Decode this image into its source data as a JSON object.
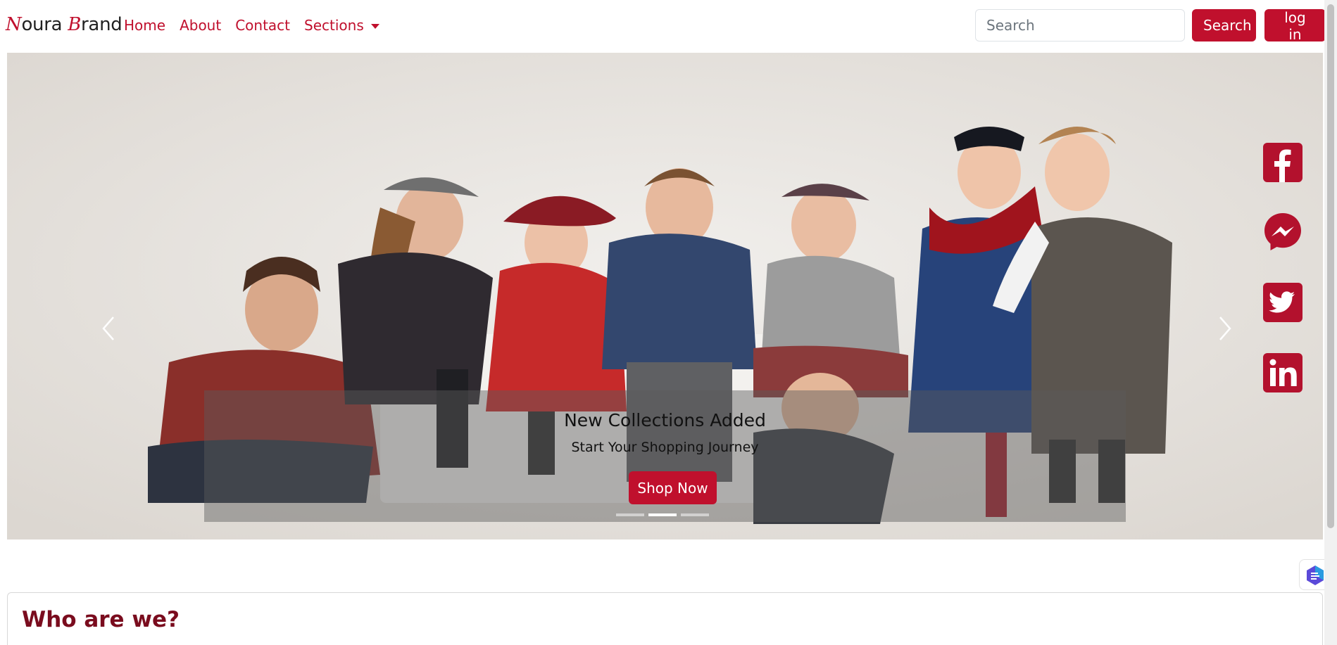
{
  "brand": {
    "initial1": "N",
    "rest1": "oura ",
    "initial2": "B",
    "rest2": "rand"
  },
  "nav": {
    "home": "Home",
    "about": "About",
    "contact": "Contact",
    "sections": "Sections"
  },
  "search": {
    "placeholder": "Search",
    "button_label": "Search"
  },
  "login_label": "log in",
  "carousel": {
    "caption_title": "New Collections Added",
    "caption_subtitle": "Start Your Shopping Journey",
    "cta_label": "Shop Now",
    "slide_count": 3,
    "active_slide": 2
  },
  "social": [
    "facebook-icon",
    "messenger-icon",
    "twitter-icon",
    "linkedin-icon"
  ],
  "section_title": "Who are we?",
  "colors": {
    "accent": "#c0102d",
    "heading": "#7a0c1e"
  }
}
